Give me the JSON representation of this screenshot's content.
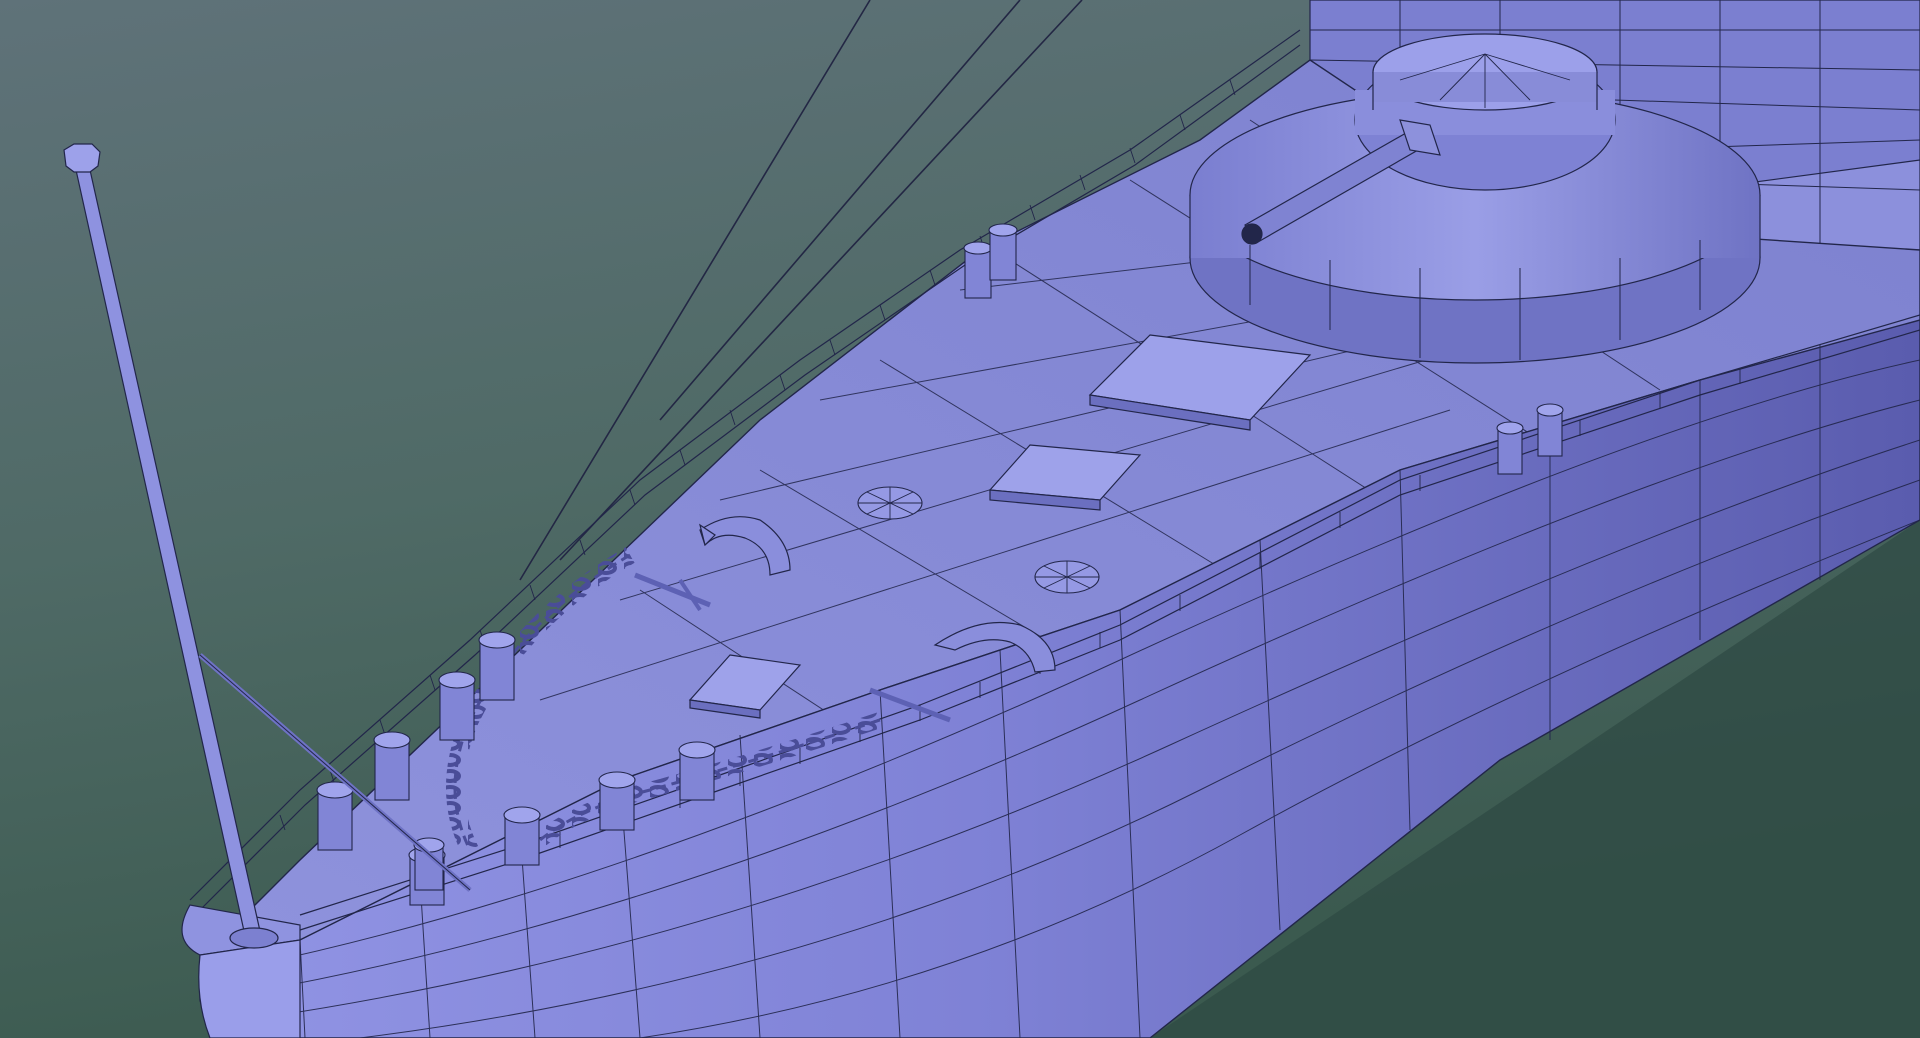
{
  "scene": {
    "subject": "wireframe-render-ship-bow",
    "colors": {
      "sky_top": "#5e7078",
      "sky_mid": "#4d6764",
      "sky_bottom": "#3c5a50",
      "water": "#2f4b45",
      "hull_light": "#8c8ee0",
      "hull_mid": "#7577cc",
      "hull_dark": "#5c5eb0",
      "deck": "#8a8ed8",
      "wire": "#22264a"
    }
  }
}
